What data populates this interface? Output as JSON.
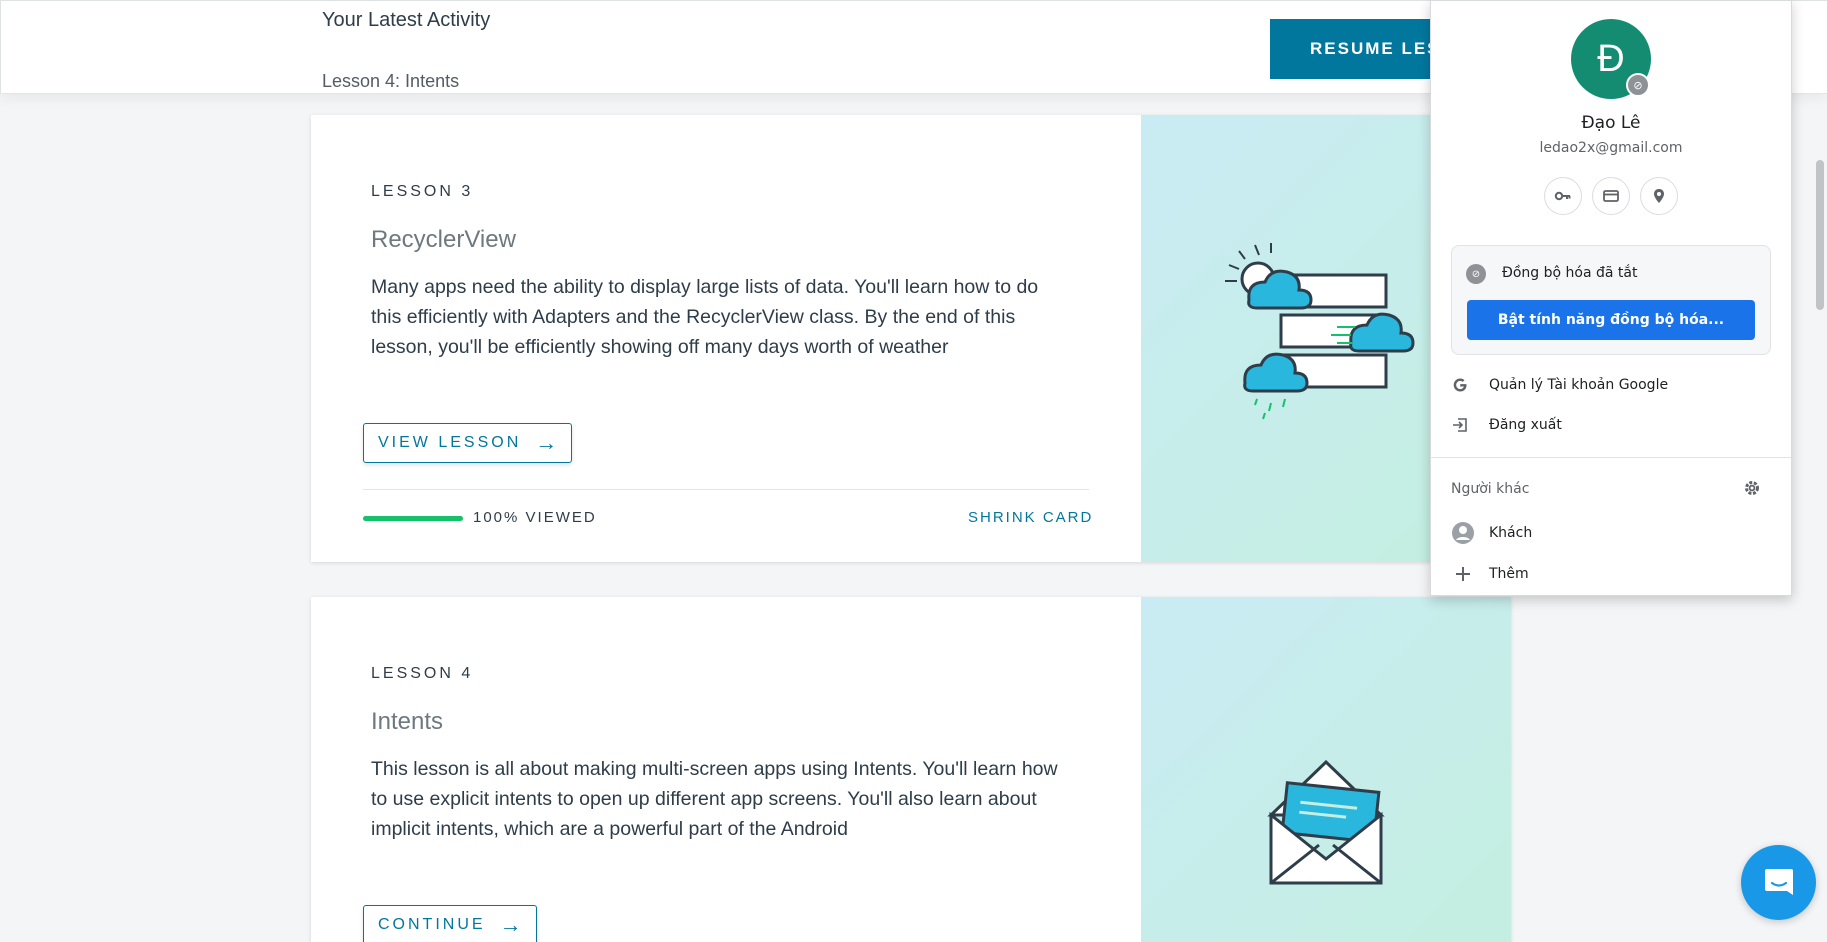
{
  "activity": {
    "title": "Your Latest Activity",
    "subtitle": "Lesson 4: Intents",
    "resume_label": "RESUME LESSON"
  },
  "lessons": [
    {
      "label": "LESSON 3",
      "name": "RecyclerView",
      "description": "Many apps need the ability to display large lists of data. You'll learn how to do this efficiently with Adapters and the RecyclerView class. By the end of this lesson, you'll be efficiently showing off many days worth of weather",
      "button_label": "VIEW LESSON",
      "progress_text": "100% VIEWED",
      "progress": 1.0,
      "shrink_label": "SHRINK CARD",
      "art_icon": "weather-list-icon"
    },
    {
      "label": "LESSON 4",
      "name": "Intents",
      "description": "This lesson is all about making multi-screen apps using Intents. You'll learn how to use explicit intents to open up different app screens. You'll also learn about implicit intents, which are a powerful part of the Android",
      "button_label": "CONTINUE",
      "art_icon": "envelope-icon"
    }
  ],
  "profile": {
    "initial": "Đ",
    "name": "Đạo Lê",
    "email": "ledao2x@gmail.com",
    "sync_status": "Đồng bộ hóa đã tắt",
    "sync_button": "Bật tính năng đồng bộ hóa...",
    "manage_account": "Quản lý Tài khoản Google",
    "sign_out": "Đăng xuất",
    "others_label": "Người khác",
    "guest": "Khách",
    "add": "Thêm"
  },
  "colors": {
    "accent": "#02779e",
    "progress": "#15c26b",
    "avatar": "#138c72",
    "sync_button": "#1a73e8",
    "chat": "#1a98e8"
  }
}
